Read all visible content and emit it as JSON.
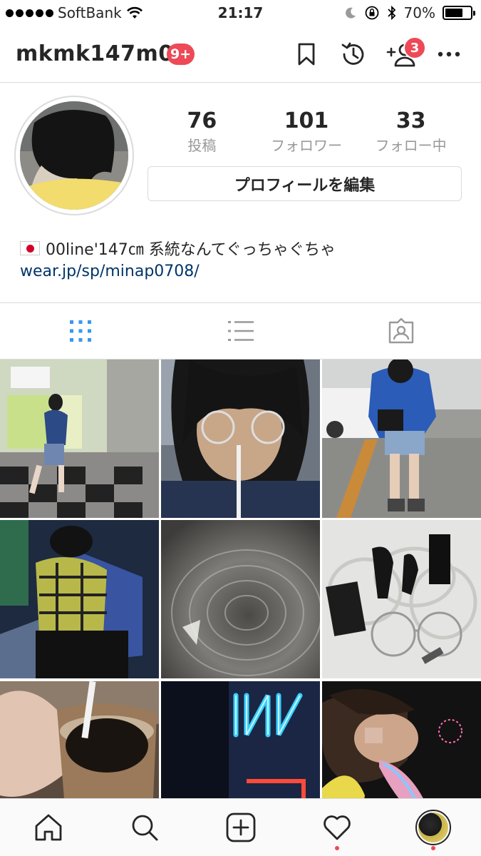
{
  "status_bar": {
    "carrier": "SoftBank",
    "time": "21:17",
    "battery": "70%",
    "battery_level": 0.7
  },
  "header": {
    "username": "mkmk147m00",
    "notification_badge": "9+",
    "follow_requests_count": "3"
  },
  "profile": {
    "stats": [
      {
        "value": "76",
        "label": "投稿"
      },
      {
        "value": "101",
        "label": "フォロワー"
      },
      {
        "value": "33",
        "label": "フォロー中"
      }
    ],
    "edit_button": "プロフィールを編集",
    "bio": "00line'147㎝ 系統なんてぐっちゃぐちゃ",
    "link": "wear.jp/sp/minap0708/"
  },
  "tabs": [
    {
      "icon": "grid-icon",
      "active": true
    },
    {
      "icon": "list-icon",
      "active": false
    },
    {
      "icon": "tagged-icon",
      "active": false
    }
  ],
  "grid": [
    {
      "subject": "girl walking in mall",
      "color": "#bfc2b8"
    },
    {
      "subject": "windblown selfie with glasses",
      "color": "#59606a"
    },
    {
      "subject": "girl in blue hoodie in parking lot",
      "color": "#b8bcbe"
    },
    {
      "subject": "plaid shirt sitting",
      "color": "#3f5b8c"
    },
    {
      "subject": "water ripples",
      "color": "#6b6a66"
    },
    {
      "subject": "clear glasses and hair ties",
      "color": "#e3e3e1"
    },
    {
      "subject": "iced coffee in copper mug",
      "color": "#7d5a3c"
    },
    {
      "subject": "neon sign",
      "color": "#141827"
    },
    {
      "subject": "girl with fireworks",
      "color": "#1c1c1c"
    }
  ],
  "bottom_nav": [
    {
      "icon": "home-icon"
    },
    {
      "icon": "search-icon"
    },
    {
      "icon": "add-post-icon"
    },
    {
      "icon": "activity-heart-icon"
    },
    {
      "icon": "profile-avatar-icon"
    }
  ],
  "colors": {
    "badge": "#ed4956",
    "link": "#003569",
    "active_tab": "#3897f0"
  }
}
